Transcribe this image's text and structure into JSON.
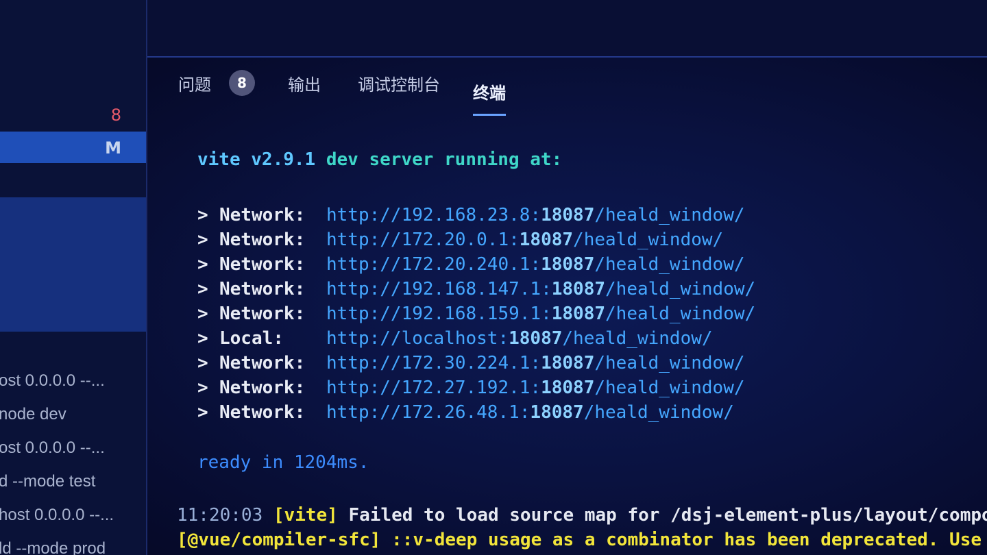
{
  "sidebar": {
    "badge_count": "8",
    "selected_status": "M",
    "scripts": [
      "ost 0.0.0.0 --...",
      "node dev",
      "ost 0.0.0.0 --...",
      "d --mode test",
      "host 0.0.0.0 --...",
      "ld --mode prod"
    ]
  },
  "panel": {
    "tabs": [
      {
        "label": "问题",
        "badge": "8"
      },
      {
        "label": "输出"
      },
      {
        "label": "调试控制台"
      },
      {
        "label": "终端",
        "active": true
      }
    ]
  },
  "terminal": {
    "banner_vite": "vite v2.9.1",
    "banner_rest": " dev server running at:",
    "arrow": ">",
    "addresses": [
      {
        "label": "Network:",
        "prefix": "http://192.168.23.8:",
        "port": "18087",
        "path": "/heald_window/"
      },
      {
        "label": "Network:",
        "prefix": "http://172.20.0.1:",
        "port": "18087",
        "path": "/heald_window/"
      },
      {
        "label": "Network:",
        "prefix": "http://172.20.240.1:",
        "port": "18087",
        "path": "/heald_window/"
      },
      {
        "label": "Network:",
        "prefix": "http://192.168.147.1:",
        "port": "18087",
        "path": "/heald_window/"
      },
      {
        "label": "Network:",
        "prefix": "http://192.168.159.1:",
        "port": "18087",
        "path": "/heald_window/"
      },
      {
        "label": "Local:",
        "prefix": "http://localhost:",
        "port": "18087",
        "path": "/heald_window/"
      },
      {
        "label": "Network:",
        "prefix": "http://172.30.224.1:",
        "port": "18087",
        "path": "/heald_window/"
      },
      {
        "label": "Network:",
        "prefix": "http://172.27.192.1:",
        "port": "18087",
        "path": "/heald_window/"
      },
      {
        "label": "Network:",
        "prefix": "http://172.26.48.1:",
        "port": "18087",
        "path": "/heald_window/"
      }
    ],
    "ready": "ready in 1204ms.",
    "log": {
      "time": "11:20:03",
      "tag": "[vite]",
      "message": "Failed to load source map for /dsj-element-plus/layout/components/B",
      "warn_tag": "[@vue/compiler-sfc]",
      "warn_message": "::v-deep usage as a combinator has been deprecated. Use :deep(<"
    }
  },
  "colors": {
    "background": "#070b2c",
    "sidebar_selected": "#1f4fb8",
    "url": "#45a7ff",
    "banner": "#3fd7c8",
    "warning": "#f2e53a"
  }
}
